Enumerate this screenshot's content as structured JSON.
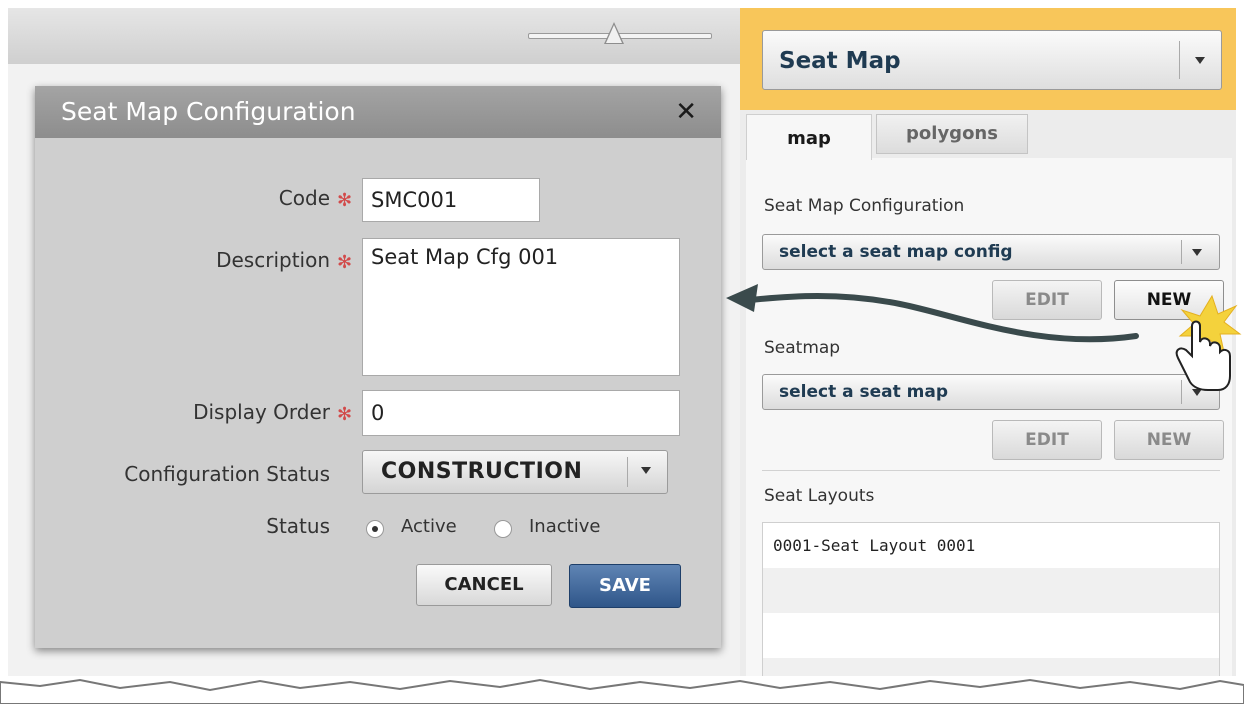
{
  "dialog": {
    "title": "Seat Map Configuration",
    "close_icon": "close-icon",
    "fields": {
      "code_label": "Code",
      "code_value": "SMC001",
      "description_label": "Description",
      "description_value": "Seat Map Cfg 001",
      "display_order_label": "Display Order",
      "display_order_value": "0",
      "config_status_label": "Configuration Status",
      "config_status_value": "CONSTRUCTION",
      "status_label": "Status",
      "status_active": "Active",
      "status_inactive": "Inactive",
      "status_selected": "Active"
    },
    "buttons": {
      "cancel": "CANCEL",
      "save": "SAVE"
    }
  },
  "right_panel": {
    "selector": "Seat Map",
    "tabs": [
      {
        "label": "map",
        "active": true
      },
      {
        "label": "polygons",
        "active": false
      }
    ],
    "seat_map_config": {
      "label": "Seat Map Configuration",
      "placeholder": "select a seat map config",
      "edit": "EDIT",
      "new": "NEW"
    },
    "seatmap": {
      "label": "Seatmap",
      "placeholder": "select a seat map",
      "edit": "EDIT",
      "new": "NEW"
    },
    "seat_layouts": {
      "label": "Seat Layouts",
      "rows": [
        "0001-Seat Layout 0001"
      ]
    }
  },
  "colors": {
    "accent": "#f8c65a",
    "save_button": "#2f5689",
    "required": "#d24a4a"
  }
}
